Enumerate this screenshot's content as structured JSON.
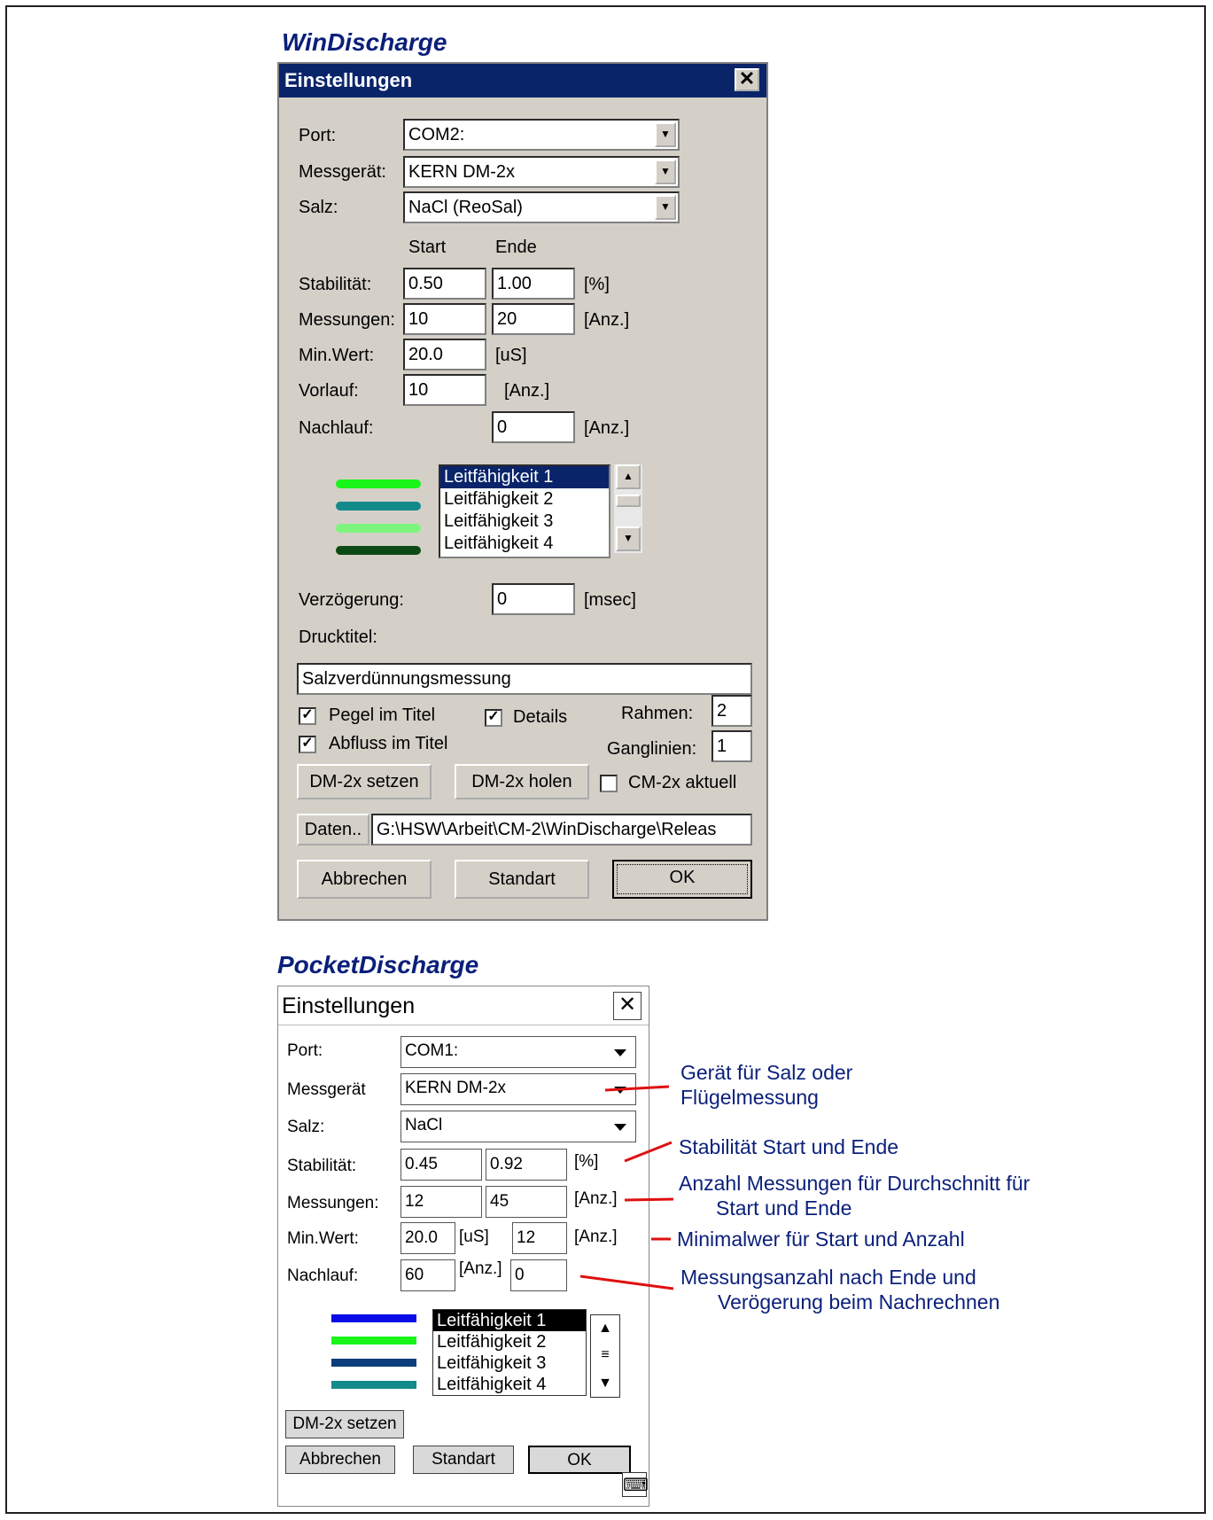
{
  "win": {
    "heading": "WinDischarge",
    "title": "Einstellungen",
    "close": "✕",
    "port_label": "Port:",
    "port_value": "COM2:",
    "messgeraet_label": "Messgerät:",
    "messgeraet_value": "KERN DM-2x",
    "salz_label": "Salz:",
    "salz_value": "NaCl (ReoSal)",
    "start_header": "Start",
    "ende_header": "Ende",
    "stabilitaet_label": "Stabilität:",
    "stabilitaet_start": "0.50",
    "stabilitaet_ende": "1.00",
    "stabilitaet_unit": "[%]",
    "messungen_label": "Messungen:",
    "messungen_start": "10",
    "messungen_ende": "20",
    "messungen_unit": "[Anz.]",
    "minwert_label": "Min.Wert:",
    "minwert_value": "20.0",
    "minwert_unit": "[uS]",
    "vorlauf_label": "Vorlauf:",
    "vorlauf_value": "10",
    "vorlauf_unit": "[Anz.]",
    "nachlauf_label": "Nachlauf:",
    "nachlauf_value": "0",
    "nachlauf_unit": "[Anz.]",
    "channels": [
      "Leitfähigkeit 1",
      "Leitfähigkeit 2",
      "Leitfähigkeit 3",
      "Leitfähigkeit 4"
    ],
    "channel_colors": [
      "#19f519",
      "#128a8a",
      "#7df57d",
      "#0b4a14"
    ],
    "verzoegerung_label": "Verzögerung:",
    "verzoegerung_value": "0",
    "verzoegerung_unit": "[msec]",
    "drucktitel_label": "Drucktitel:",
    "drucktitel_value": "Salzverdünnungsmessung",
    "pegel_label": "Pegel im Titel",
    "details_label": "Details",
    "abfluss_label": "Abfluss im Titel",
    "rahmen_label": "Rahmen:",
    "rahmen_value": "2",
    "ganglinien_label": "Ganglinien:",
    "ganglinien_value": "1",
    "dm_setzen": "DM-2x setzen",
    "dm_holen": "DM-2x holen",
    "cm_aktuell": "CM-2x aktuell",
    "daten_button": "Daten..",
    "daten_path": "G:\\HSW\\Arbeit\\CM-2\\WinDischarge\\Releas",
    "abbrechen": "Abbrechen",
    "standart": "Standart",
    "ok": "OK"
  },
  "pocket": {
    "heading": "PocketDischarge",
    "title": "Einstellungen",
    "close": "✕",
    "port_label": "Port:",
    "port_value": "COM1:",
    "messgeraet_label": "Messgerät",
    "messgeraet_value": "KERN DM-2x",
    "salz_label": "Salz:",
    "salz_value": "NaCl",
    "stabilitaet_label": "Stabilität:",
    "stabilitaet_start": "0.45",
    "stabilitaet_ende": "0.92",
    "stabilitaet_unit": "[%]",
    "messungen_label": "Messungen:",
    "messungen_start": "12",
    "messungen_ende": "45",
    "messungen_unit": "[Anz.]",
    "minwert_label": "Min.Wert:",
    "minwert_value": "20.0",
    "minwert_unit": "[uS]",
    "minwert_anzahl": "12",
    "minwert_anzahl_unit": "[Anz.]",
    "nachlauf_label": "Nachlauf:",
    "nachlauf_value": "60",
    "nachlauf_unit": "[Anz.]",
    "verzoegerung_value": "0",
    "channels": [
      "Leitfähigkeit 1",
      "Leitfähigkeit 2",
      "Leitfähigkeit 3",
      "Leitfähigkeit 4"
    ],
    "channel_colors": [
      "#0a0ae6",
      "#19f519",
      "#0a3d7a",
      "#128a8a"
    ],
    "dm_setzen": "DM-2x setzen",
    "abbrechen": "Abbrechen",
    "standart": "Standart",
    "ok": "OK"
  },
  "annotations": {
    "geraet_line1": "Gerät für Salz oder",
    "geraet_line2": "Flügelmessung",
    "stabilitaet": "Stabilität Start und Ende",
    "anzahl_line1": "Anzahl Messungen für Durchschnitt für",
    "anzahl_line2": "Start und Ende",
    "minimalwert": "Minimalwer für Start und Anzahl",
    "messungsanzahl_line1": "Messungsanzahl nach Ende und",
    "messungsanzahl_line2": "Verögerung beim Nachrechnen",
    "line_color": "#e01010"
  }
}
